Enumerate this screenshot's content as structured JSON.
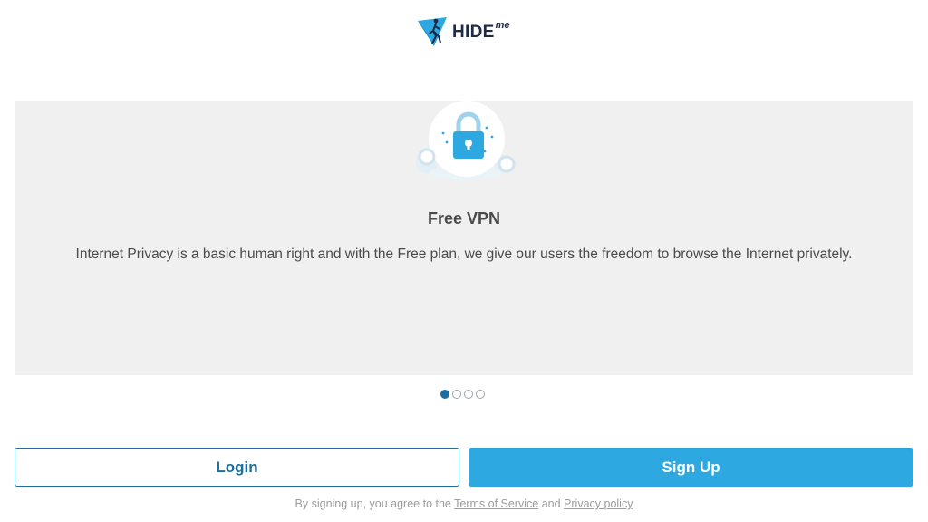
{
  "header": {
    "logo_text": "HIDE",
    "logo_sup": "me",
    "logo_icon": "hideme-runner-icon",
    "brand_color": "#2ea8e0"
  },
  "carousel": {
    "illustration": "padlock-icon",
    "title": "Free VPN",
    "text": "Internet Privacy is a basic human right and with the Free plan, we give our users the freedom to browse the Internet privately.",
    "active_slide": 1,
    "slide_count": 4
  },
  "buttons": {
    "login_label": "Login",
    "signup_label": "Sign Up"
  },
  "footer": {
    "prefix": "By signing up, you agree to the",
    "terms_label": "Terms of Service",
    "and": "and",
    "privacy_label": "Privacy policy"
  },
  "colors": {
    "accent": "#2ea8e0",
    "login_border": "#1c6e9e",
    "panel_bg": "#f0f0f0"
  }
}
